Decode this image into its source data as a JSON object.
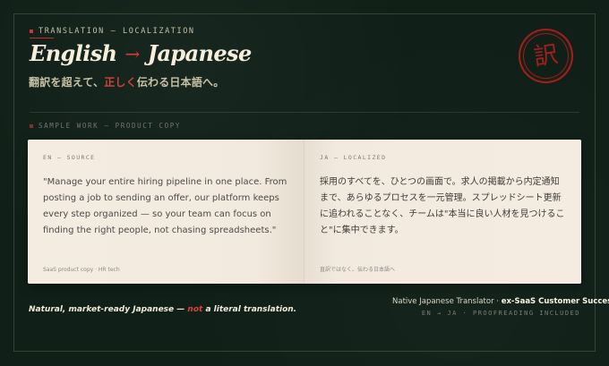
{
  "header": {
    "eyebrow": "TRANSLATION — LOCALIZATION",
    "title_left": "English",
    "title_arrow": "→",
    "title_right": "Japanese",
    "tagline_before": "翻訳を超えて、",
    "tagline_highlight": "正しく",
    "tagline_after": "伝わる日本語へ。",
    "stamp_glyph": "訳"
  },
  "section": {
    "label": "SAMPLE WORK — PRODUCT COPY"
  },
  "book": {
    "source": {
      "label": "EN — SOURCE",
      "text": "\"Manage your entire hiring pipeline in one place. From posting a job to sending an offer, our platform keeps every step organized — so your team can focus on finding the right people, not chasing spreadsheets.\"",
      "footnote": "SaaS product copy · HR tech"
    },
    "localized": {
      "label": "JA — LOCALIZED",
      "text": "採用のすべてを、ひとつの画面で。求人の掲載から内定通知まで、あらゆるプロセスを一元管理。スプレッドシート更新に追われることなく、チームは\"本当に良い人材を見つけること\"に集中できます。",
      "footnote": "直訳ではなく、伝わる日本語へ"
    }
  },
  "footer": {
    "statement_before": "Natural, market-ready Japanese — ",
    "statement_highlight": "not",
    "statement_after": " a literal translation.",
    "credit_plain": "Native Japanese Translator · ",
    "credit_bold": "ex-SaaS Customer Success",
    "meta": "EN → JA · PROOFREADING INCLUDED"
  },
  "colors": {
    "background": "#102018",
    "paper": "#f4ece1",
    "accent_red": "#d0352d",
    "ink_light": "#f6efdc",
    "muted": "#7b7d76"
  }
}
